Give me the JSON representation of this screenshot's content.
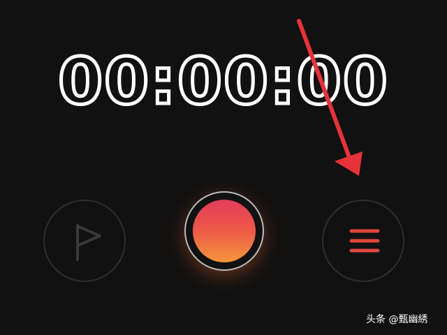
{
  "timer": {
    "display": "00:00:00"
  },
  "controls": {
    "flag_icon": "flag-icon",
    "record_icon": "record-icon",
    "menu_icon": "menu-icon"
  },
  "colors": {
    "background": "#111111",
    "record_top": "#e23c5a",
    "record_bottom": "#f5953a",
    "menu_icon": "#e0463e",
    "annotation_arrow": "#e8323a"
  },
  "watermark": {
    "text": "头条 @甄幽綉"
  }
}
